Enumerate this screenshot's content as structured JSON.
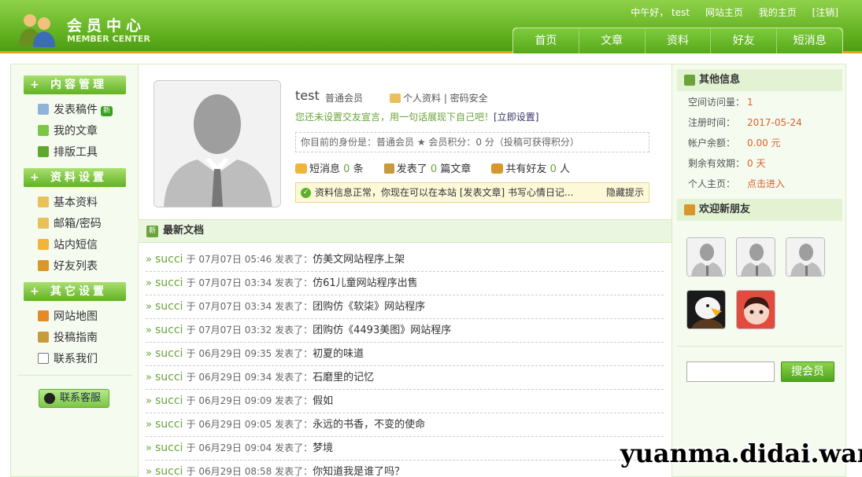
{
  "header": {
    "logo_title": "会员中心",
    "logo_sub": "MEMBER CENTER",
    "greeting": "中午好， test",
    "site_home": "网站主页",
    "my_home": "我的主页",
    "logout": "[注销]",
    "nav": [
      "首页",
      "文章",
      "资料",
      "好友",
      "短消息"
    ]
  },
  "sidebar": {
    "sections": [
      {
        "title": "内容管理",
        "items": [
          "发表稿件",
          "我的文章",
          "排版工具"
        ],
        "badge": "新"
      },
      {
        "title": "资料设置",
        "items": [
          "基本资料",
          "邮箱/密码",
          "站内短信",
          "好友列表"
        ]
      },
      {
        "title": "其它设置",
        "items": [
          "网站地图",
          "投稿指南",
          "联系我们"
        ]
      }
    ],
    "plus": "+",
    "kefu": "联系客服"
  },
  "profile": {
    "username": "test",
    "usergroup": "普通会员",
    "links": "个人资料 | 密码安全",
    "sign_tip": "您还未设置交友宣言，用一句话展现下自己吧！",
    "sign_link": "[立即设置]",
    "identity": "你目前的身份是：普通会员 ★ 会员积分：0 分（投稿可获得积分）",
    "stats": {
      "msg_label": "短消息",
      "msg_count": "0",
      "msg_unit": "条",
      "post_label": "发表了",
      "post_count": "0",
      "post_unit": "篇文章",
      "friend_label": "共有好友",
      "friend_count": "0",
      "friend_unit": "人"
    },
    "notice": "资料信息正常，你现在可以在本站 [发表文章] 书写心情日记...",
    "notice_hide": "隐藏提示",
    "notice_check": "✓"
  },
  "latest": {
    "title": "最新文档",
    "icon_text": "新",
    "arrow": "»",
    "rows": [
      {
        "author": "succi",
        "time": "于 07月07日 05:46 发表了：",
        "title": "仿美文网站程序上架"
      },
      {
        "author": "succi",
        "time": "于 07月07日 03:34 发表了：",
        "title": "仿61儿童网站程序出售"
      },
      {
        "author": "succi",
        "time": "于 07月07日 03:34 发表了：",
        "title": "团购仿《软柒》网站程序"
      },
      {
        "author": "succi",
        "time": "于 07月07日 03:32 发表了：",
        "title": "团购仿《4493美图》网站程序"
      },
      {
        "author": "succi",
        "time": "于 06月29日 09:35 发表了：",
        "title": "初夏的味道"
      },
      {
        "author": "succi",
        "time": "于 06月29日 09:34 发表了：",
        "title": "石磨里的记忆"
      },
      {
        "author": "succi",
        "time": "于 06月29日 09:09 发表了：",
        "title": "假如"
      },
      {
        "author": "succi",
        "time": "于 06月29日 09:05 发表了：",
        "title": "永远的书香，不变的使命"
      },
      {
        "author": "succi",
        "time": "于 06月29日 09:04 发表了：",
        "title": "梦境"
      },
      {
        "author": "succi",
        "time": "于 06月29日 08:58 发表了：",
        "title": "你知道我是谁了吗？"
      }
    ]
  },
  "right": {
    "other_title": "其他信息",
    "info": [
      {
        "label": "空间访问量：",
        "value": "1"
      },
      {
        "label": "注册时间：",
        "value": "2017-05-24"
      },
      {
        "label": "帐户余额：",
        "value": "0.00 元"
      },
      {
        "label": "剩余有效期：",
        "value": "0 天"
      },
      {
        "label": "个人主页：",
        "value": "点击进入"
      }
    ],
    "friends_title": "欢迎新朋友",
    "search_btn": "搜会员",
    "search_value": ""
  },
  "watermark": "yuanma.didai.wang"
}
